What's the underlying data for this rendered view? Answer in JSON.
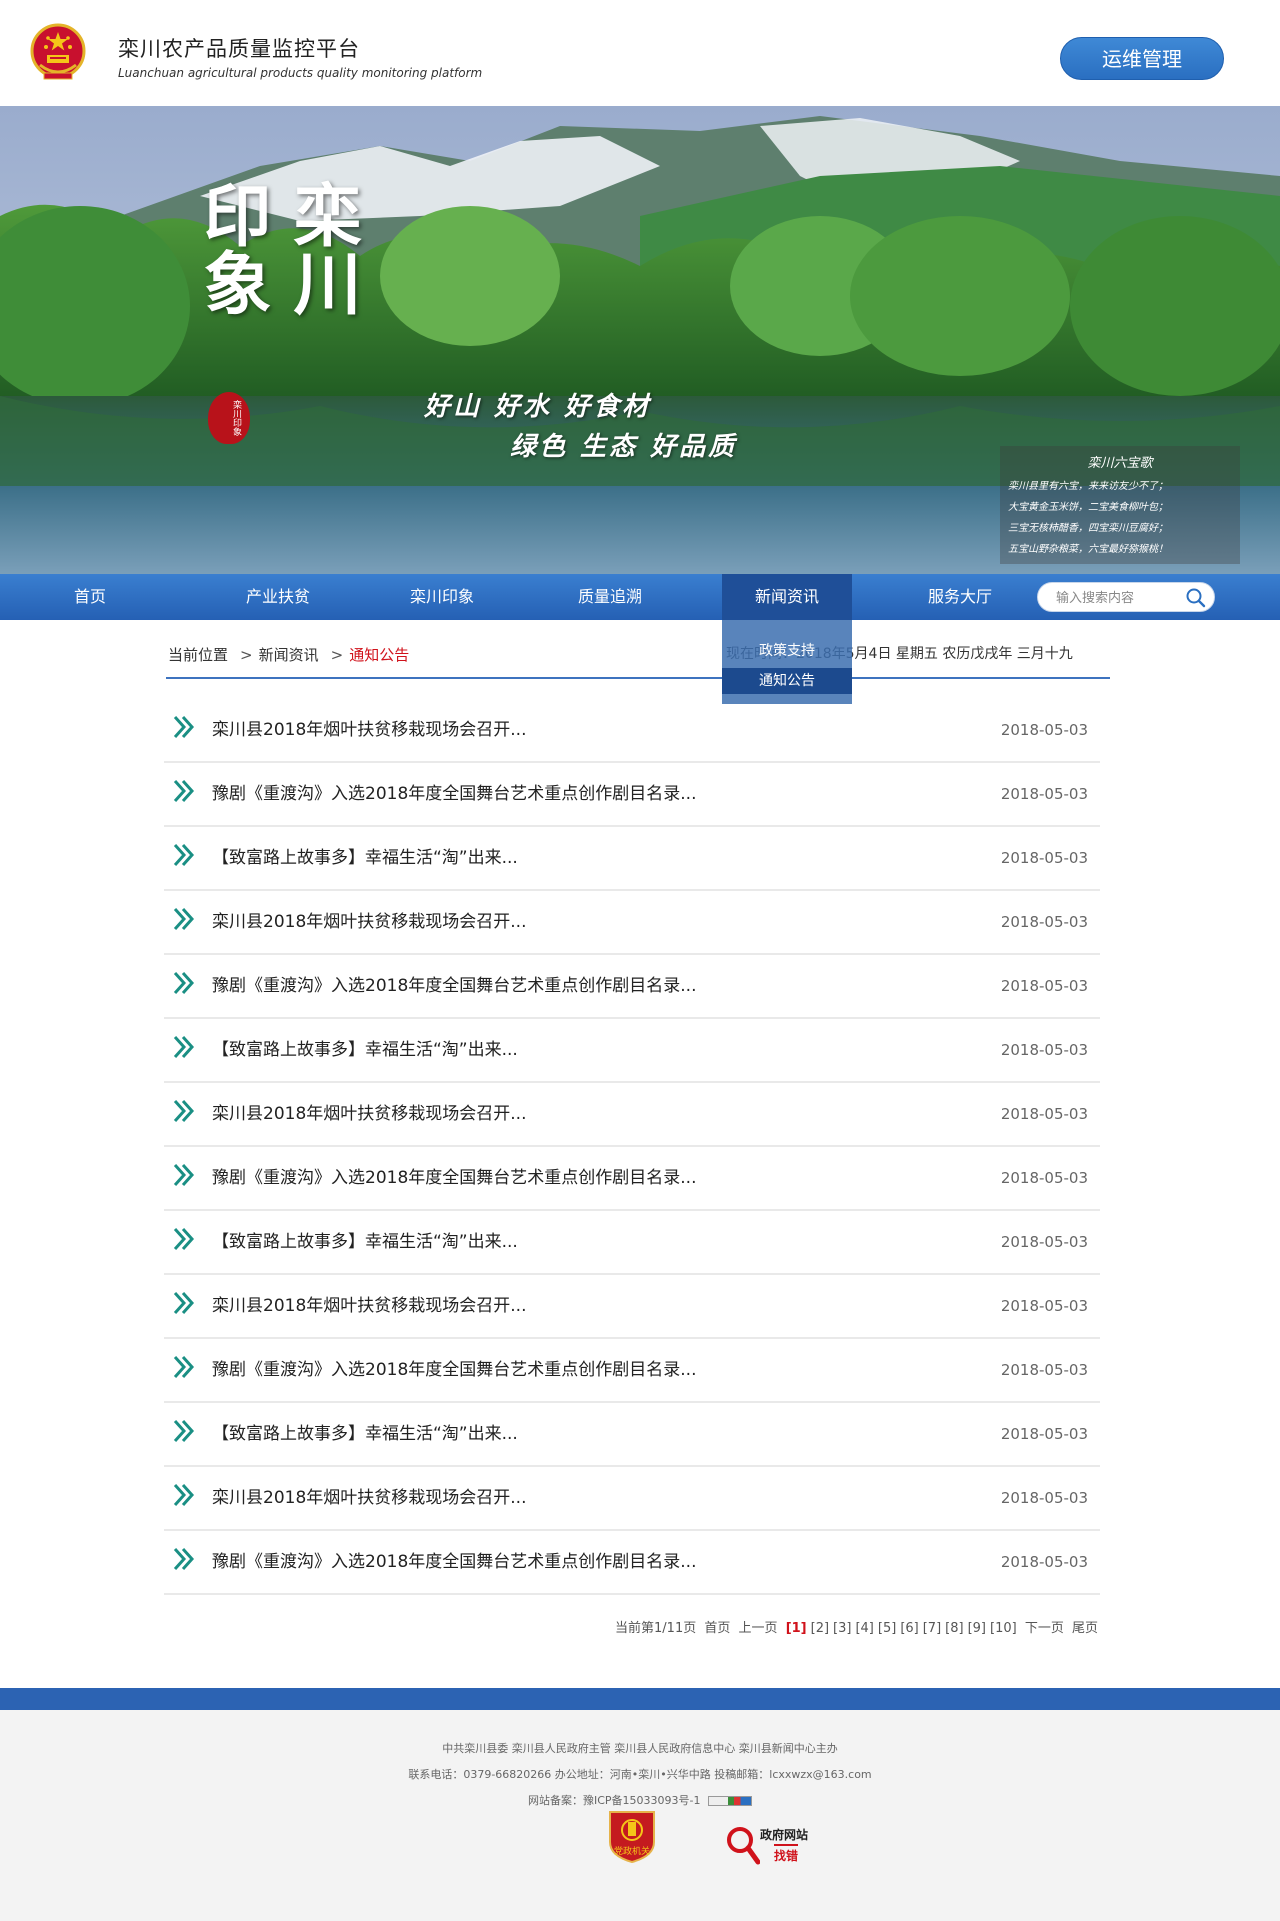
{
  "header": {
    "title": "栾川农产品质量监控平台",
    "subtitle": "Luanchuan agricultural products quality monitoring platform",
    "ops_button": "运维管理"
  },
  "banner": {
    "calligraphy": "栾川印象",
    "seal": "栾川印象",
    "slogan_1": "好山 好水 好食材",
    "slogan_2": "绿色 生态 好品质",
    "poem_title": "栾川六宝歌",
    "poem_lines": [
      "栾川县里有六宝，来来访友少不了；",
      "大宝黄金玉米饼，二宝美食柳叶包；",
      "三宝无核柿醋香，四宝栾川豆腐好；",
      "五宝山野杂粮菜，六宝最好猕猴桃！"
    ]
  },
  "nav": {
    "items": [
      "首页",
      "产业扶贫",
      "栾川印象",
      "质量追溯",
      "新闻资讯",
      "服务大厅"
    ],
    "active": "新闻资讯",
    "search_placeholder": "输入搜索内容",
    "dropdown": [
      "政策支持",
      "通知公告"
    ]
  },
  "breadcrumb": {
    "label": "当前位置",
    "sep": ">",
    "parent": "新闻资讯",
    "current": "通知公告",
    "datetime": "现在时间：2018年5月4日 星期五 农历戊戌年 三月十九"
  },
  "news": [
    {
      "title": "栾川县2018年烟叶扶贫移栽现场会召开...",
      "date": "2018-05-03"
    },
    {
      "title": "豫剧《重渡沟》入选2018年度全国舞台艺术重点创作剧目名录...",
      "date": "2018-05-03"
    },
    {
      "title": "【致富路上故事多】幸福生活“淘”出来...",
      "date": "2018-05-03"
    },
    {
      "title": "栾川县2018年烟叶扶贫移栽现场会召开...",
      "date": "2018-05-03"
    },
    {
      "title": "豫剧《重渡沟》入选2018年度全国舞台艺术重点创作剧目名录...",
      "date": "2018-05-03"
    },
    {
      "title": "【致富路上故事多】幸福生活“淘”出来...",
      "date": "2018-05-03"
    },
    {
      "title": "栾川县2018年烟叶扶贫移栽现场会召开...",
      "date": "2018-05-03"
    },
    {
      "title": "豫剧《重渡沟》入选2018年度全国舞台艺术重点创作剧目名录...",
      "date": "2018-05-03"
    },
    {
      "title": "【致富路上故事多】幸福生活“淘”出来...",
      "date": "2018-05-03"
    },
    {
      "title": "栾川县2018年烟叶扶贫移栽现场会召开...",
      "date": "2018-05-03"
    },
    {
      "title": "豫剧《重渡沟》入选2018年度全国舞台艺术重点创作剧目名录...",
      "date": "2018-05-03"
    },
    {
      "title": "【致富路上故事多】幸福生活“淘”出来...",
      "date": "2018-05-03"
    },
    {
      "title": "栾川县2018年烟叶扶贫移栽现场会召开...",
      "date": "2018-05-03"
    },
    {
      "title": "豫剧《重渡沟》入选2018年度全国舞台艺术重点创作剧目名录...",
      "date": "2018-05-03"
    }
  ],
  "pager": {
    "info": "当前第1/11页",
    "first": "首页",
    "prev": "上一页",
    "pages": [
      "[1]",
      "[2]",
      "[3]",
      "[4]",
      "[5]",
      "[6]",
      "[7]",
      "[8]",
      "[9]",
      "[10]"
    ],
    "current_index": 0,
    "next": "下一页",
    "last": "尾页"
  },
  "footer": {
    "line1": "中共栾川县委   栾川县人民政府主管      栾川县人民政府信息中心   栾川县新闻中心主办",
    "line2": "联系电话：0379-66820266       办公地址：河南•栾川•兴华中路       投稿邮箱：lcxxwzx@163.com",
    "line3": "网站备案：豫ICP备15033093号-1",
    "badge_party": "党政机关",
    "badge_gov_title": "政府网站",
    "badge_gov_sub": "找错"
  },
  "colors": {
    "primary_blue": "#2a6fc1",
    "accent_red": "#d0121b",
    "chevron_teal": "#1a8f84"
  }
}
